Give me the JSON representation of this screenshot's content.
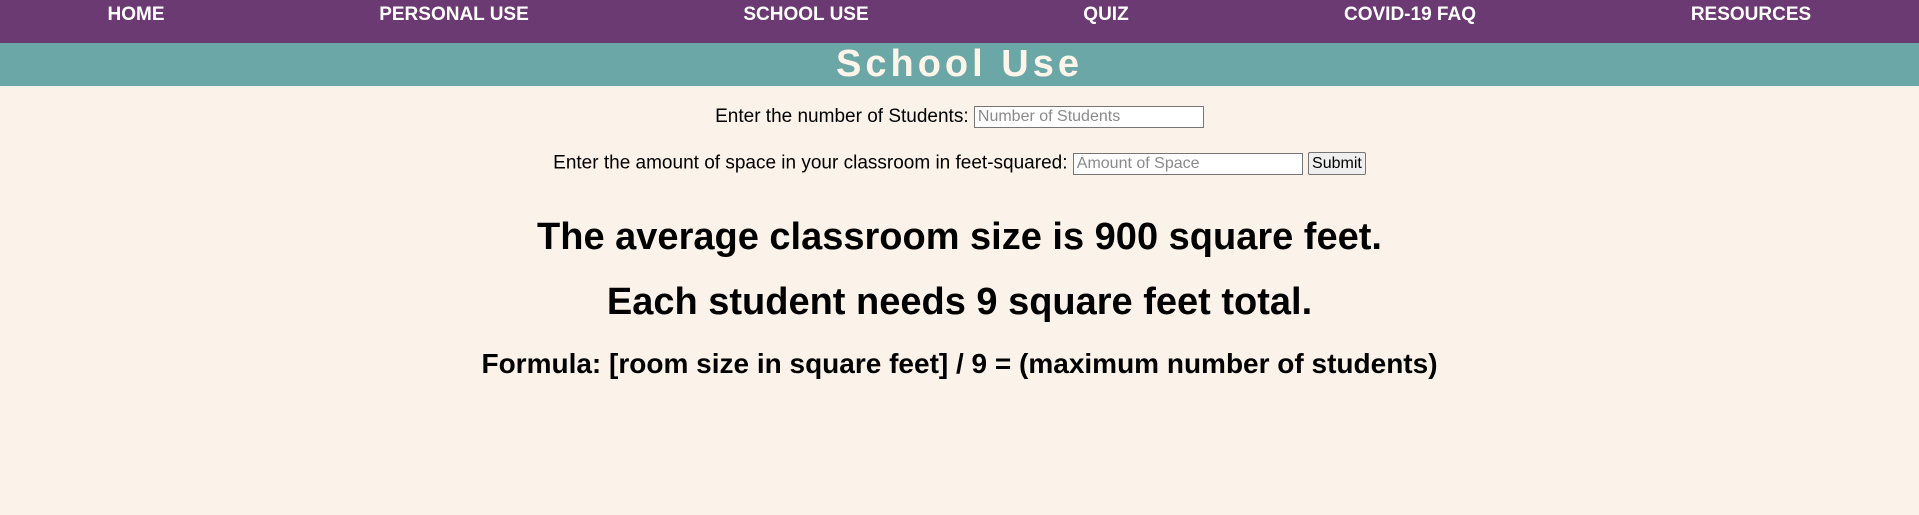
{
  "nav": {
    "items": [
      {
        "label": "HOME"
      },
      {
        "label": "PERSONAL USE"
      },
      {
        "label": "SCHOOL USE"
      },
      {
        "label": "QUIZ"
      },
      {
        "label": "COVID-19 FAQ"
      },
      {
        "label": "RESOURCES"
      }
    ]
  },
  "banner": {
    "title": "School Use"
  },
  "form": {
    "students_label": "Enter the number of Students:",
    "students_placeholder": "Number of Students",
    "students_value": "",
    "space_label": "Enter the amount of space in your classroom in feet-squared:",
    "space_placeholder": "Amount of Space",
    "space_value": "",
    "submit_label": "Submit"
  },
  "info": {
    "average_text": "The average classroom size is 900 square feet.",
    "per_student_text": "Each student needs 9 square feet total.",
    "formula_text": "Formula: [room size in square feet] / 9 = (maximum number of students)"
  },
  "colors": {
    "nav_bg": "#6c3a72",
    "banner_bg": "#6ba7a6",
    "page_bg": "#fbf3e9"
  }
}
